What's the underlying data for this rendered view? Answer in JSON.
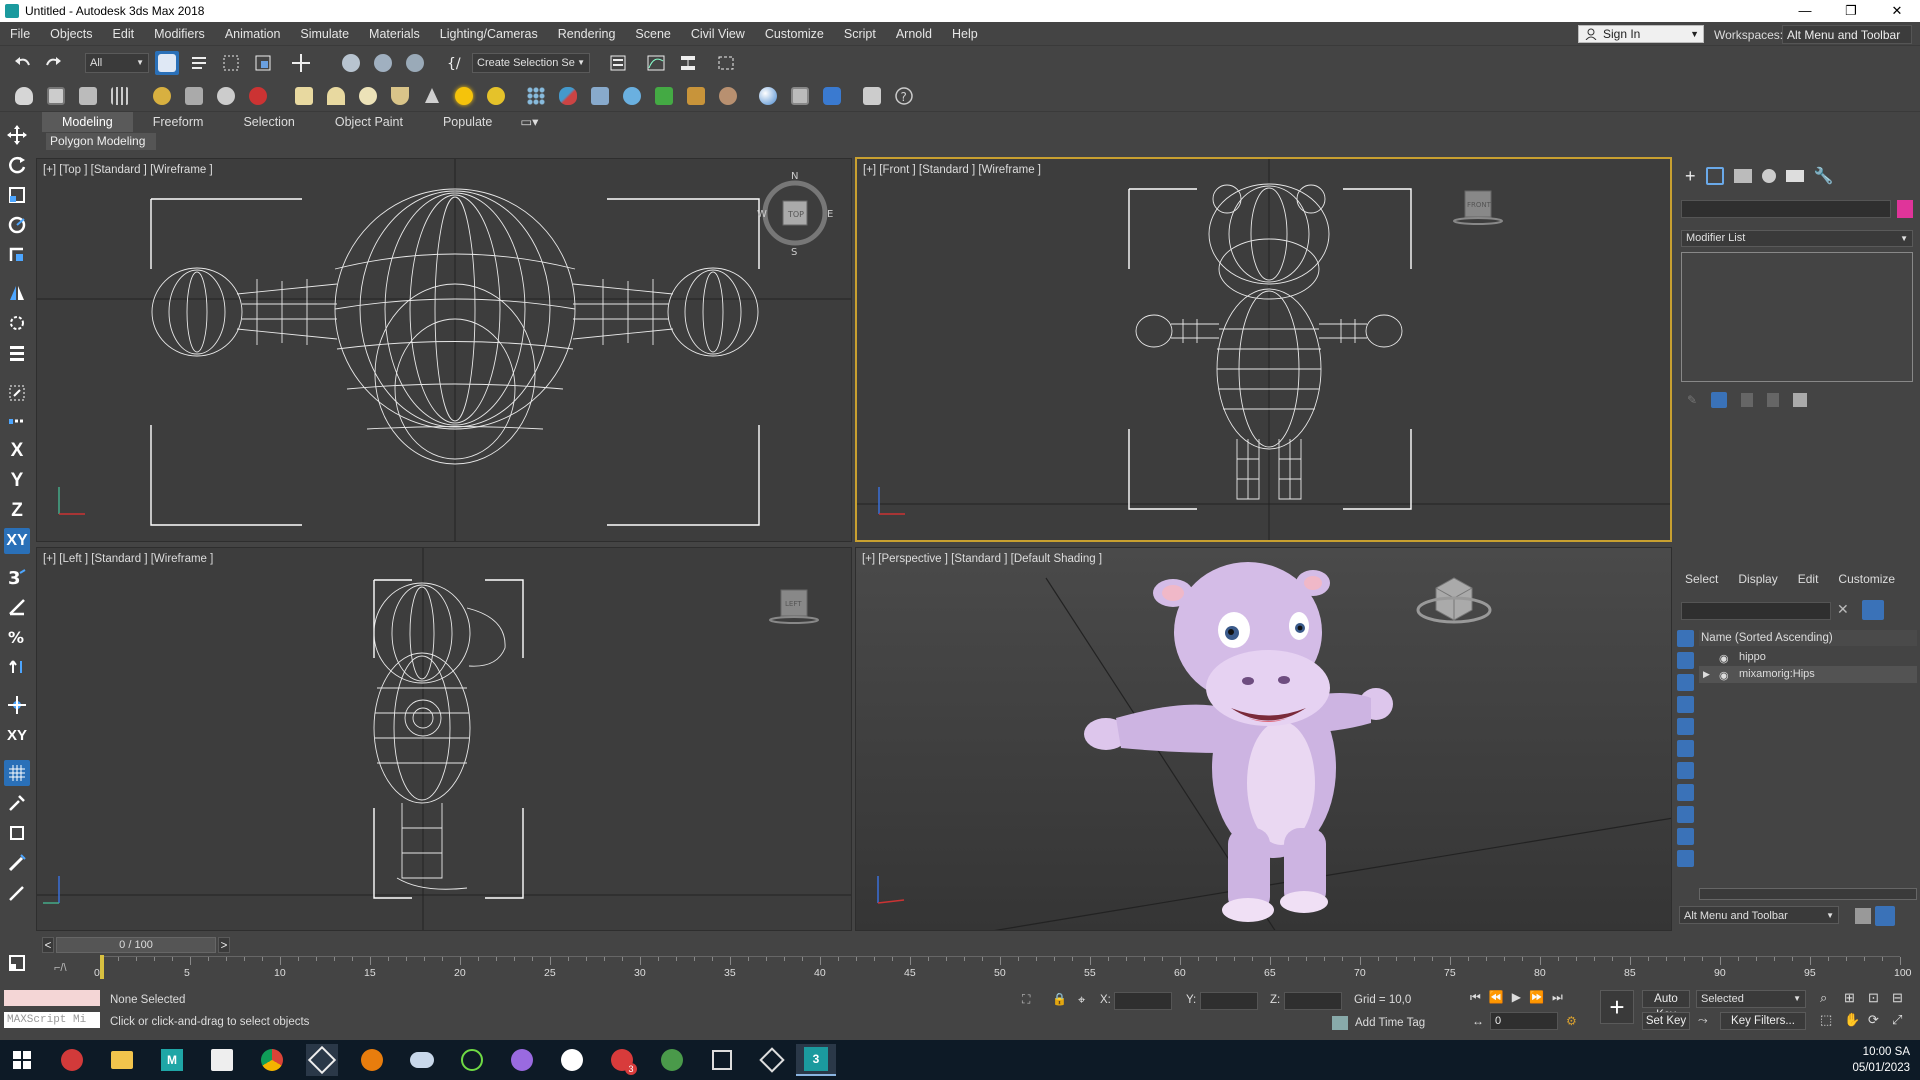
{
  "window": {
    "title": "Untitled - Autodesk 3ds Max 2018",
    "minimize": "—",
    "restore": "❐",
    "close": "✕"
  },
  "menu": [
    "File",
    "Objects",
    "Edit",
    "Modifiers",
    "Animation",
    "Simulate",
    "Materials",
    "Lighting/Cameras",
    "Rendering",
    "Scene",
    "Civil View",
    "Customize",
    "Script",
    "Arnold",
    "Help"
  ],
  "account": {
    "sign_in": "Sign In",
    "workspaces_label": "Workspaces:",
    "workspace": "Alt Menu and Toolbar"
  },
  "toolbar": {
    "filter": "All",
    "selection_set": "Create Selection Se"
  },
  "ribbon": {
    "tabs": [
      "Modeling",
      "Freeform",
      "Selection",
      "Object Paint",
      "Populate"
    ],
    "panel": "Polygon Modeling"
  },
  "axis_tools": [
    "X",
    "Y",
    "Z",
    "XY"
  ],
  "viewports": {
    "top": {
      "label": "[+] [Top ] [Standard ] [Wireframe ]",
      "cube": "TOP",
      "compass": [
        "N",
        "S",
        "E",
        "W"
      ]
    },
    "front": {
      "label": "[+] [Front ] [Standard ] [Wireframe ]",
      "cube": "FRONT"
    },
    "left": {
      "label": "[+] [Left ] [Standard ] [Wireframe ]",
      "cube": "LEFT"
    },
    "persp": {
      "label": "[+] [Perspective ] [Standard ] [Default Shading ]"
    }
  },
  "command_panel": {
    "modifier_list": "Modifier List",
    "object_color": "#e0349a"
  },
  "scene_explorer": {
    "tabs": [
      "Select",
      "Display",
      "Edit",
      "Customize"
    ],
    "column_header": "Name (Sorted Ascending)",
    "items": [
      "hippo",
      "mixamorig:Hips"
    ],
    "workspace": "Alt Menu and Toolbar"
  },
  "timeline": {
    "counter": "0 / 100",
    "ticks": [
      "0",
      "5",
      "10",
      "15",
      "20",
      "25",
      "30",
      "35",
      "40",
      "45",
      "50",
      "55",
      "60",
      "65",
      "70",
      "75",
      "80",
      "85",
      "90",
      "95",
      "100"
    ]
  },
  "status": {
    "maxscript": "MAXScript Mi",
    "selection": "None Selected",
    "prompt": "Click or click-and-drag to select objects",
    "x_label": "X:",
    "y_label": "Y:",
    "z_label": "Z:",
    "grid": "Grid = 10,0",
    "add_time_tag": "Add Time Tag",
    "auto_key": "Auto Key",
    "set_key": "Set Key",
    "key_mode": "Selected",
    "key_filters": "Key Filters...",
    "frame": "0"
  },
  "clock": {
    "time": "10:00 SA",
    "date": "05/01/2023"
  },
  "taskbar": {
    "icons": [
      "windows-start-icon",
      "autodesk-icon",
      "file-explorer-icon",
      "maya-icon",
      "photoshop-icon",
      "chrome-icon",
      "unity-icon",
      "blender-icon",
      "cloud-icon",
      "upwork-icon",
      "github-icon",
      "webex-icon",
      "discord-icon",
      "unreal-icon",
      "package-icon",
      "unity2-icon",
      "3dsmax-icon"
    ],
    "badge": "3"
  }
}
